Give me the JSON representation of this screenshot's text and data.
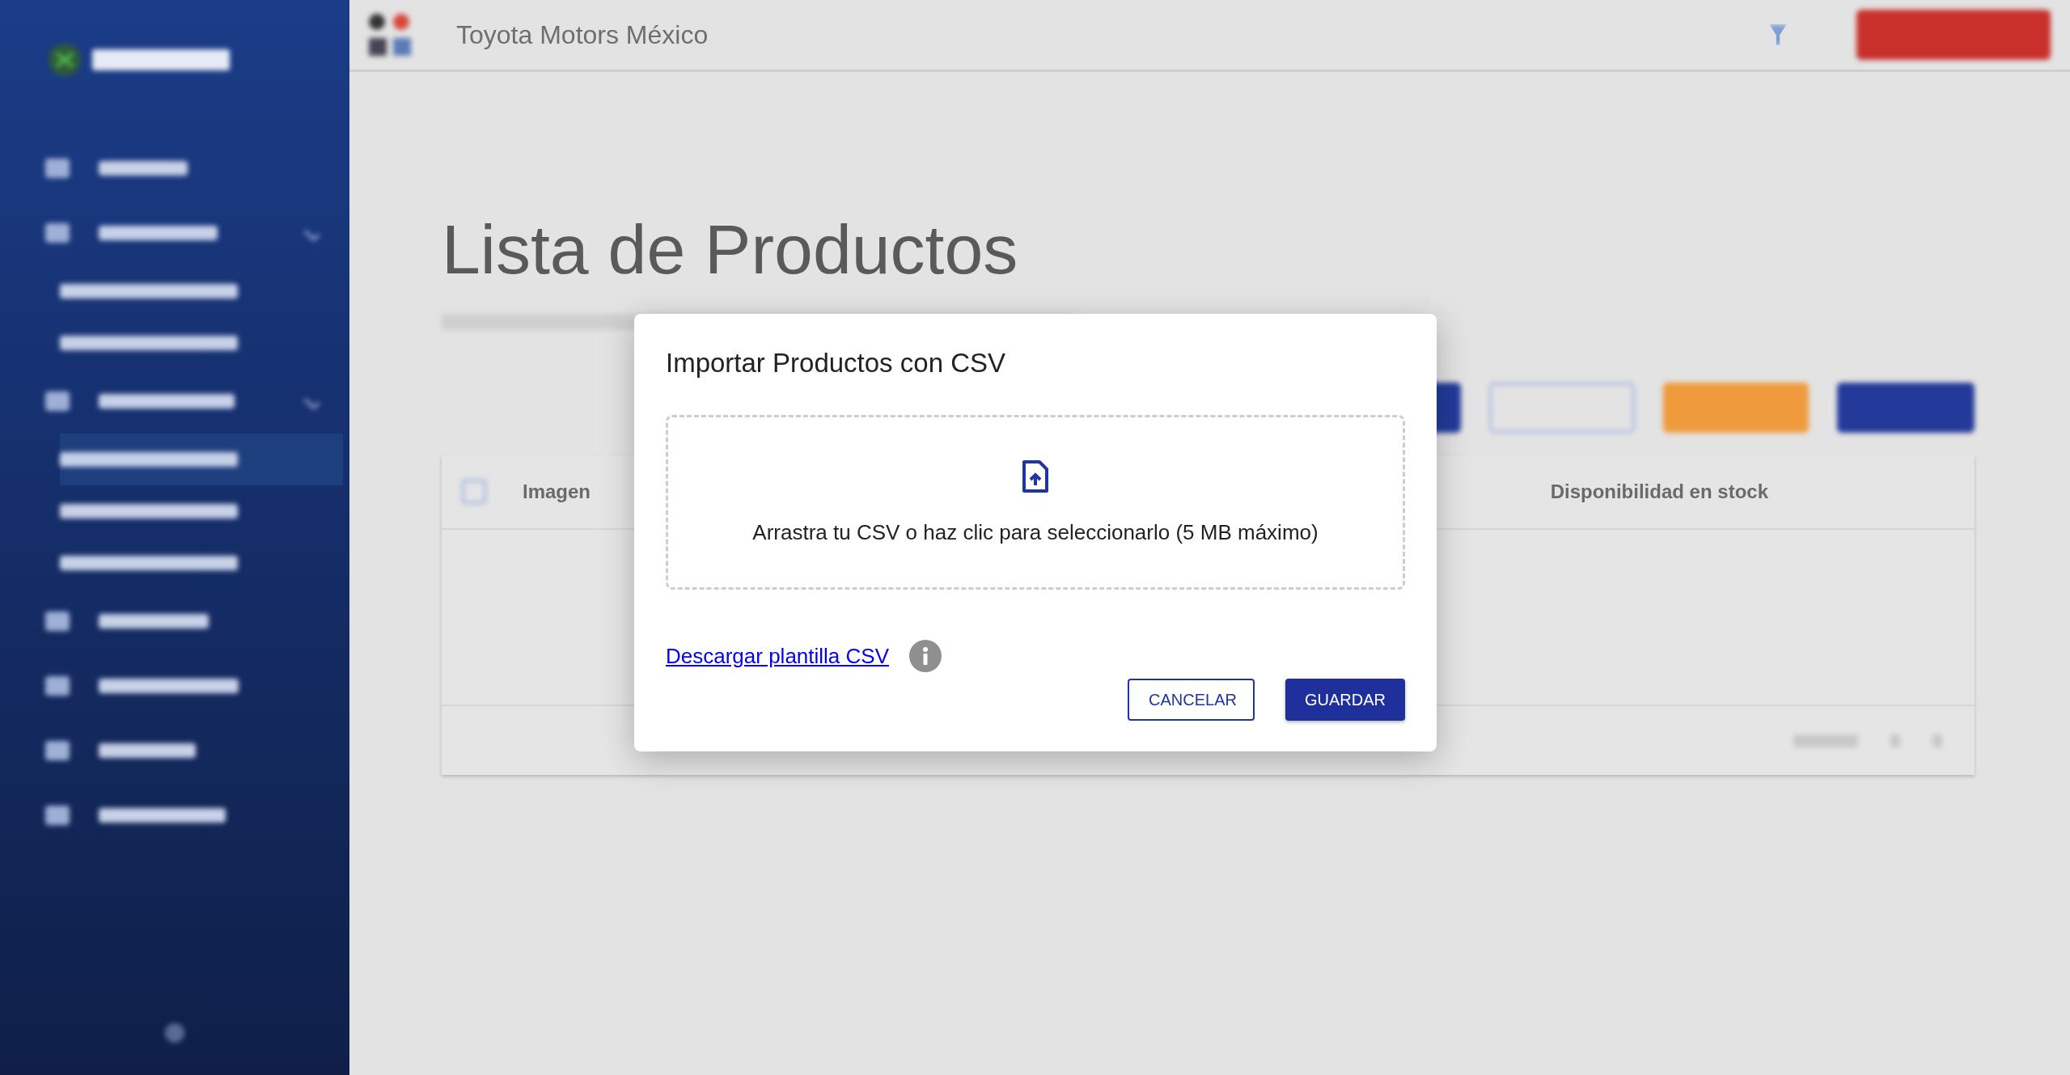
{
  "sidebar": {
    "items": [
      {
        "kind": "main",
        "selected": false
      },
      {
        "kind": "group",
        "selected": false
      },
      {
        "kind": "sub",
        "selected": false
      },
      {
        "kind": "sub",
        "selected": false
      },
      {
        "kind": "group",
        "selected": false
      },
      {
        "kind": "sub",
        "selected": true
      },
      {
        "kind": "sub",
        "selected": false
      },
      {
        "kind": "sub",
        "selected": false
      },
      {
        "kind": "main",
        "selected": false
      },
      {
        "kind": "main",
        "selected": false
      },
      {
        "kind": "main",
        "selected": false
      },
      {
        "kind": "main",
        "selected": false
      }
    ]
  },
  "topbar": {
    "company": "Toyota Motors México"
  },
  "page": {
    "title": "Lista de Productos",
    "table": {
      "select_all": {
        "checked": false
      },
      "columns": [
        "Imagen",
        "Disponibilidad en stock"
      ]
    }
  },
  "dialog": {
    "title": "Importar Productos con CSV",
    "dropzone_text": "Arrastra tu CSV o haz clic para seleccionarlo (5 MB máximo)",
    "template_link": "Descargar plantilla CSV",
    "buttons": [
      {
        "label": "CANCELAR",
        "kind": "outlined"
      },
      {
        "label": "GUARDAR",
        "kind": "contained"
      }
    ]
  }
}
